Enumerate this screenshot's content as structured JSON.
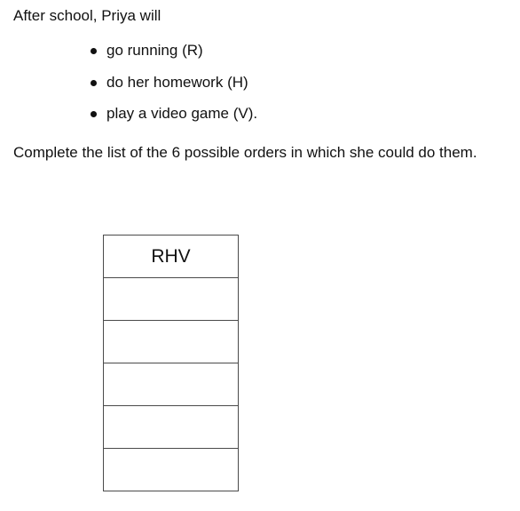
{
  "intro_text": "After school, Priya will",
  "activities": [
    "go running (R)",
    "do her homework (H)",
    "play a video game (V)."
  ],
  "instruction_text": "Complete the list of the 6 possible orders in which she could do them.",
  "answer_table": {
    "rows": [
      "RHV",
      "",
      "",
      "",
      "",
      ""
    ]
  }
}
